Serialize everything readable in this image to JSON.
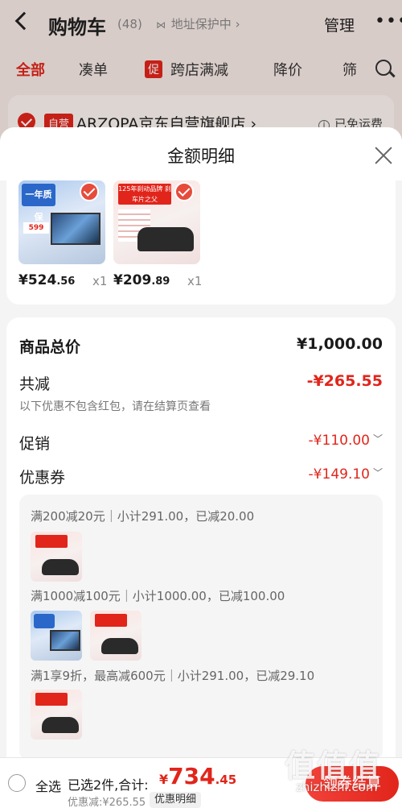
{
  "header": {
    "title": "购物车",
    "count": "(48)",
    "address_protect": "地址保护中",
    "manage": "管理",
    "more_icon": "more-dots-icon"
  },
  "filter_tabs": [
    {
      "label": "全部",
      "active": true
    },
    {
      "label": "凑单"
    },
    {
      "label": "跨店满减",
      "badge": "促"
    },
    {
      "label": "降价"
    },
    {
      "label": "筛"
    }
  ],
  "store": {
    "badge": "自营",
    "name": "ARZOPA京东自营旗舰店 ›",
    "shipping": "已免运费"
  },
  "sheet": {
    "title": "金额明细",
    "products": [
      {
        "price_int": "¥524",
        "price_dec": ".56",
        "qty": "x1",
        "img_tag": "一年质保",
        "img_price": "599"
      },
      {
        "price_int": "¥209",
        "price_dec": ".89",
        "qty": "x1",
        "img_tag": "125年刹动品牌 刹车片之父"
      }
    ],
    "total_label": "商品总价",
    "total_value": "¥1,000.00",
    "reduce_label": "共减",
    "reduce_value": "-¥265.55",
    "note": "以下优惠不包含红包，请在结算页查看",
    "promo_label": "促销",
    "promo_value": "-¥110.00",
    "coupon_label": "优惠券",
    "coupon_value": "-¥149.10",
    "promo_lines": [
      "满200减20元｜小计291.00，已减20.00",
      "满1000减100元｜小计1000.00，已减100.00",
      "满1享9折，最高减600元｜小计291.00，已减29.10"
    ]
  },
  "bottom": {
    "select_all": "全选",
    "selected": "已选2件,合计:",
    "total_sym": "¥",
    "total_int": "734",
    "total_dec": ".45",
    "discount": "优惠减:¥265.55",
    "detail_btn": "优惠明细",
    "checkout": "领券结算"
  },
  "watermark": {
    "logo": "值值值",
    "url": "zhizhizhi.com"
  },
  "colors": {
    "accent": "#e1251b",
    "sheet_bg": "#f4f4f4"
  }
}
